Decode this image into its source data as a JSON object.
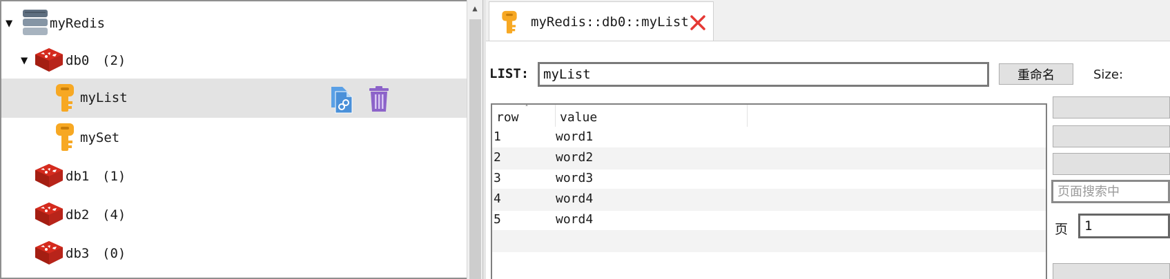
{
  "tree": {
    "server": {
      "name": "myRedis",
      "expanded_glyph": "▼",
      "icon": "server-stack-icon"
    },
    "db0": {
      "name": "db0",
      "count": "(2)",
      "expanded_glyph": "▼",
      "icon": "redis-db-icon"
    },
    "keys": [
      {
        "name": "myList",
        "icon": "key-icon",
        "selected": true
      },
      {
        "name": "mySet",
        "icon": "key-icon",
        "selected": false
      }
    ],
    "dbs": [
      {
        "name": "db1",
        "count": "(1)",
        "icon": "redis-db-icon"
      },
      {
        "name": "db2",
        "count": "(4)",
        "icon": "redis-db-icon"
      },
      {
        "name": "db3",
        "count": "(0)",
        "icon": "redis-db-icon"
      }
    ],
    "row_actions": {
      "copy_icon": "copy-link-icon",
      "delete_icon": "trash-icon"
    }
  },
  "scrollbar": {
    "up_glyph": "▲"
  },
  "tab": {
    "label": "myRedis::db0::myList",
    "icon": "key-icon",
    "close_icon": "close-x-icon"
  },
  "editor": {
    "type_label": "LIST:",
    "key_name": "myList",
    "rename_label": "重命名",
    "size_label": "Size:"
  },
  "table": {
    "headers": [
      "row",
      "value"
    ],
    "rows": [
      {
        "row": "1",
        "value": "word1"
      },
      {
        "row": "2",
        "value": "word2"
      },
      {
        "row": "3",
        "value": "word3"
      },
      {
        "row": "4",
        "value": "word4"
      },
      {
        "row": "5",
        "value": "word4"
      }
    ]
  },
  "side": {
    "search_placeholder": "页面搜索中",
    "page_label": "页",
    "page_value": "1"
  },
  "colors": {
    "redis_red": "#d52b1e",
    "key_orange": "#f7a823",
    "trash_purple": "#8c63c9",
    "copy_blue": "#4a90d9",
    "close_red": "#e53935",
    "selected_row": "#e3e3e3"
  }
}
